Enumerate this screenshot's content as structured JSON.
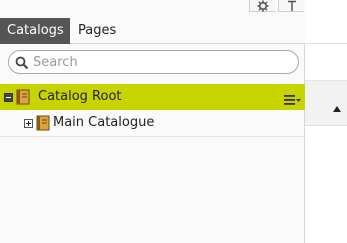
{
  "panel": {
    "tabs": [
      {
        "label": "Catalogs",
        "active": true
      },
      {
        "label": "Pages",
        "active": false
      }
    ],
    "search": {
      "placeholder": "Search",
      "value": ""
    },
    "tree": [
      {
        "label": "Catalog Root",
        "expanded": true,
        "selected": true,
        "icon": "catalog-book-icon"
      },
      {
        "label": "Main Catalogue",
        "expanded": false,
        "selected": false,
        "icon": "catalog-book-icon"
      }
    ],
    "toolbar_icons": [
      "gear-icon",
      "pin-icon"
    ]
  },
  "colors": {
    "accent_selected": "#c8d400",
    "active_tab": "#555555",
    "panel_bg": "#fafafa"
  },
  "right": {
    "icons": [
      "caret-up-icon"
    ]
  }
}
